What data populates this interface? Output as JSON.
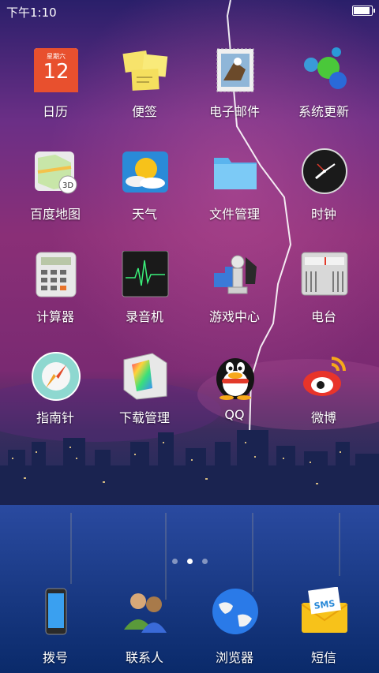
{
  "status_bar": {
    "time": "下午1:10",
    "battery_level": 1.0
  },
  "apps": [
    {
      "label": "日历",
      "icon": "calendar-icon",
      "weekday": "星期六",
      "day": "12"
    },
    {
      "label": "便签",
      "icon": "notes-icon"
    },
    {
      "label": "电子邮件",
      "icon": "mail-icon"
    },
    {
      "label": "系统更新",
      "icon": "system-update-icon"
    },
    {
      "label": "百度地图",
      "icon": "map-icon"
    },
    {
      "label": "天气",
      "icon": "weather-icon"
    },
    {
      "label": "文件管理",
      "icon": "folder-icon"
    },
    {
      "label": "时钟",
      "icon": "clock-icon"
    },
    {
      "label": "计算器",
      "icon": "calculator-icon"
    },
    {
      "label": "录音机",
      "icon": "recorder-icon"
    },
    {
      "label": "游戏中心",
      "icon": "game-center-icon"
    },
    {
      "label": "电台",
      "icon": "radio-icon"
    },
    {
      "label": "指南针",
      "icon": "compass-icon"
    },
    {
      "label": "下载管理",
      "icon": "download-manager-icon"
    },
    {
      "label": "QQ",
      "icon": "qq-icon"
    },
    {
      "label": "微博",
      "icon": "weibo-icon"
    }
  ],
  "page_indicator": {
    "pages": 3,
    "current": 2
  },
  "dock": [
    {
      "label": "拨号",
      "icon": "phone-icon"
    },
    {
      "label": "联系人",
      "icon": "contacts-icon"
    },
    {
      "label": "浏览器",
      "icon": "browser-icon"
    },
    {
      "label": "短信",
      "icon": "sms-icon",
      "badge_text": "SMS"
    }
  ]
}
